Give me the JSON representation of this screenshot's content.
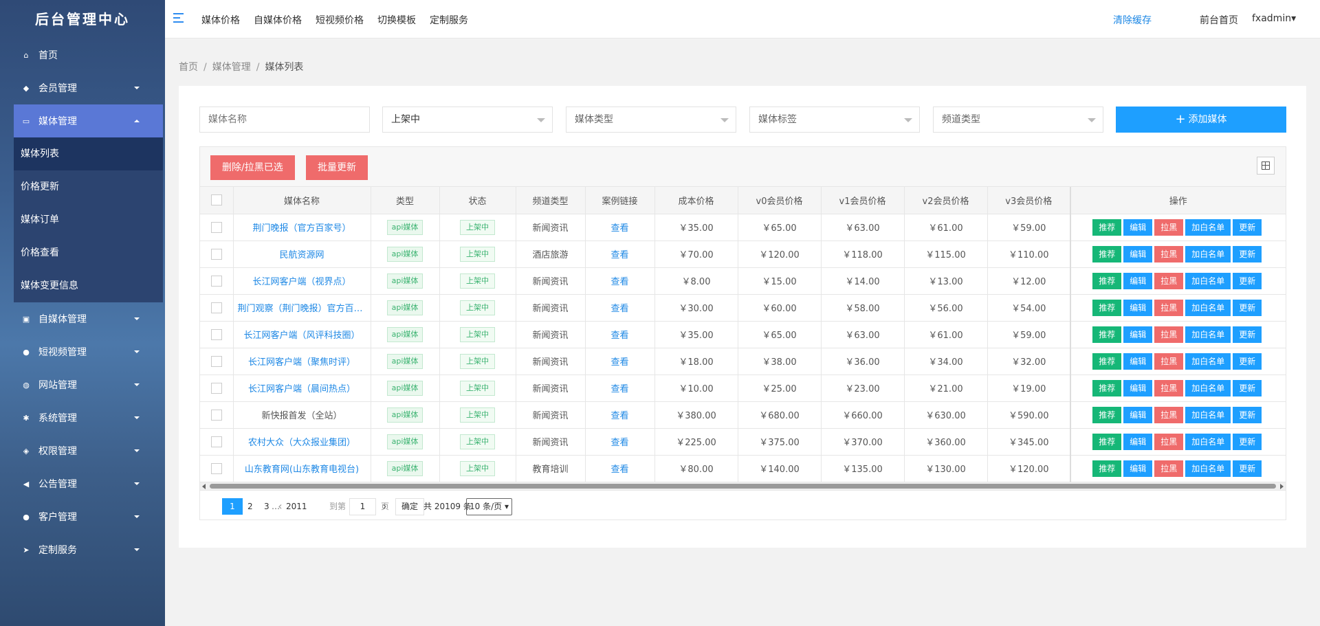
{
  "app": {
    "title": "后台管理中心"
  },
  "sidebar": {
    "items": [
      {
        "label": "首页",
        "icon": "home-icon",
        "glyph": "⌂"
      },
      {
        "label": "会员管理",
        "icon": "diamond-icon",
        "glyph": "◆"
      },
      {
        "label": "媒体管理",
        "icon": "media-icon",
        "glyph": "▭",
        "active": true,
        "children": [
          "媒体列表",
          "价格更新",
          "媒体订单",
          "价格查看",
          "媒体变更信息"
        ]
      },
      {
        "label": "自媒体管理",
        "icon": "id-card-icon",
        "glyph": "▣"
      },
      {
        "label": "短视频管理",
        "icon": "user-icon",
        "glyph": "●"
      },
      {
        "label": "网站管理",
        "icon": "globe-icon",
        "glyph": "◍"
      },
      {
        "label": "系统管理",
        "icon": "gear-icon",
        "glyph": "✱"
      },
      {
        "label": "权限管理",
        "icon": "shield-icon",
        "glyph": "◈"
      },
      {
        "label": "公告管理",
        "icon": "megaphone-icon",
        "glyph": "◀"
      },
      {
        "label": "客户管理",
        "icon": "users-icon",
        "glyph": "●"
      },
      {
        "label": "定制服务",
        "icon": "send-icon",
        "glyph": "➤"
      }
    ]
  },
  "topbar": {
    "links": [
      "媒体价格",
      "自媒体价格",
      "短视频价格",
      "切换模板",
      "定制服务"
    ],
    "clear_cache": "清除缓存",
    "front_home": "前台首页",
    "user": "fxadmin▾"
  },
  "breadcrumb": {
    "home": "首页",
    "section": "媒体管理",
    "current": "媒体列表",
    "sep": "/"
  },
  "filters": {
    "name_placeholder": "媒体名称",
    "status_value": "上架中",
    "type_placeholder": "媒体类型",
    "tag_placeholder": "媒体标签",
    "channel_placeholder": "频道类型",
    "add_label": "添加媒体"
  },
  "toolbar": {
    "delete_label": "删除/拉黑已选",
    "batch_update_label": "批量更新"
  },
  "table": {
    "headers": [
      "媒体名称",
      "类型",
      "状态",
      "频道类型",
      "案例链接",
      "成本价格",
      "v0会员价格",
      "v1会员价格",
      "v2会员价格",
      "v3会员价格",
      "操作"
    ],
    "actions": [
      "推荐",
      "编辑",
      "拉黑",
      "加白名单",
      "更新"
    ],
    "rows": [
      {
        "name": "荆门晚报（官方百家号）",
        "type": "api媒体",
        "status": "上架中",
        "channel": "新闻资讯",
        "link": "查看",
        "cost": "￥35.00",
        "v0": "￥65.00",
        "v1": "￥63.00",
        "v2": "￥61.00",
        "v3": "￥59.00"
      },
      {
        "name": "民航资源网",
        "type": "api媒体",
        "status": "上架中",
        "channel": "酒店旅游",
        "link": "查看",
        "cost": "￥70.00",
        "v0": "￥120.00",
        "v1": "￥118.00",
        "v2": "￥115.00",
        "v3": "￥110.00"
      },
      {
        "name": "长江网客户端（视界点）",
        "type": "api媒体",
        "status": "上架中",
        "channel": "新闻资讯",
        "link": "查看",
        "cost": "￥8.00",
        "v0": "￥15.00",
        "v1": "￥14.00",
        "v2": "￥13.00",
        "v3": "￥12.00"
      },
      {
        "name": "荆门观察（荆门晚报）官方百家号",
        "type": "api媒体",
        "status": "上架中",
        "channel": "新闻资讯",
        "link": "查看",
        "cost": "￥30.00",
        "v0": "￥60.00",
        "v1": "￥58.00",
        "v2": "￥56.00",
        "v3": "￥54.00"
      },
      {
        "name": "长江网客户端（风评科技圈）",
        "type": "api媒体",
        "status": "上架中",
        "channel": "新闻资讯",
        "link": "查看",
        "cost": "￥35.00",
        "v0": "￥65.00",
        "v1": "￥63.00",
        "v2": "￥61.00",
        "v3": "￥59.00"
      },
      {
        "name": "长江网客户端（聚焦时评）",
        "type": "api媒体",
        "status": "上架中",
        "channel": "新闻资讯",
        "link": "查看",
        "cost": "￥18.00",
        "v0": "￥38.00",
        "v1": "￥36.00",
        "v2": "￥34.00",
        "v3": "￥32.00"
      },
      {
        "name": "长江网客户端（晨间热点）",
        "type": "api媒体",
        "status": "上架中",
        "channel": "新闻资讯",
        "link": "查看",
        "cost": "￥10.00",
        "v0": "￥25.00",
        "v1": "￥23.00",
        "v2": "￥21.00",
        "v3": "￥19.00"
      },
      {
        "name": "新快报首发（全站）",
        "type": "api媒体",
        "status": "上架中",
        "channel": "新闻资讯",
        "link": "查看",
        "cost": "￥380.00",
        "v0": "￥680.00",
        "v1": "￥660.00",
        "v2": "￥630.00",
        "v3": "￥590.00",
        "plain": true
      },
      {
        "name": "农村大众（大众报业集团）",
        "type": "api媒体",
        "status": "上架中",
        "channel": "新闻资讯",
        "link": "查看",
        "cost": "￥225.00",
        "v0": "￥375.00",
        "v1": "￥370.00",
        "v2": "￥360.00",
        "v3": "￥345.00"
      },
      {
        "name": "山东教育网(山东教育电视台)",
        "type": "api媒体",
        "status": "上架中",
        "channel": "教育培训",
        "link": "查看",
        "cost": "￥80.00",
        "v0": "￥140.00",
        "v1": "￥135.00",
        "v2": "￥130.00",
        "v3": "￥120.00"
      }
    ]
  },
  "pagination": {
    "prev": "‹",
    "next": "›",
    "pages": [
      "1",
      "2",
      "3"
    ],
    "ellipsis": "…",
    "last": "2011",
    "goto_label": "到第",
    "goto_value": "1",
    "page_unit": "页",
    "confirm": "确定",
    "total": "共 20109 条",
    "limit": "10 条/页 ▾"
  },
  "colors": {
    "accent": "#1e9fff",
    "danger": "#ef6b6b",
    "success": "#16b777",
    "sidebar_active": "#5a78d6"
  }
}
